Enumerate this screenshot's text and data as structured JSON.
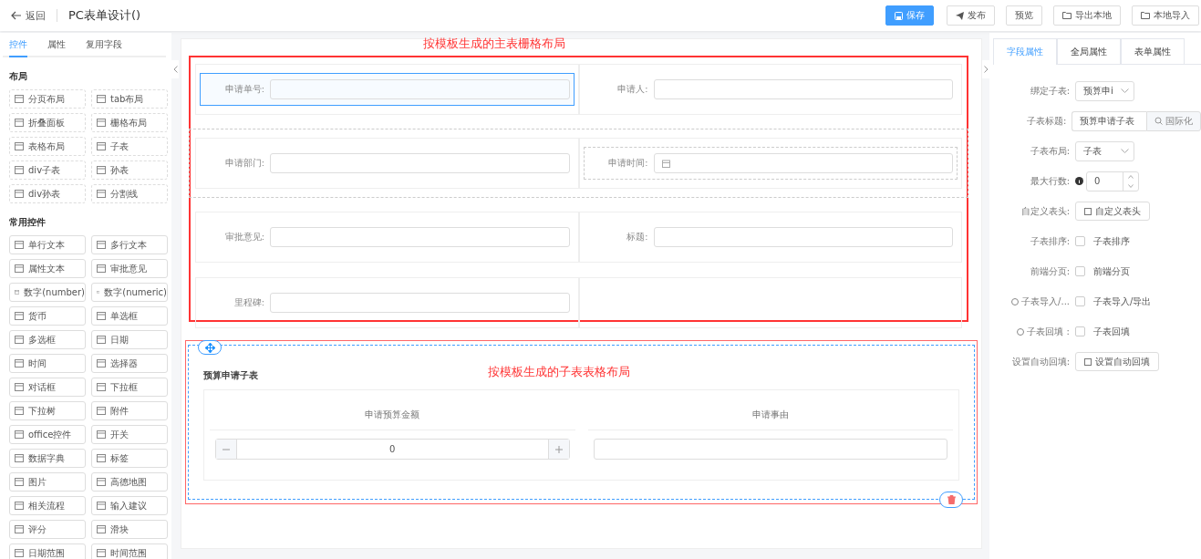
{
  "header": {
    "back_label": "返回",
    "title": "PC表单设计()",
    "buttons": [
      {
        "label": "保存",
        "kind": "primary"
      },
      {
        "label": "发布",
        "kind": "send"
      },
      {
        "label": "预览",
        "kind": "plain"
      },
      {
        "label": "导出本地",
        "kind": "folder"
      },
      {
        "label": "本地导入",
        "kind": "folder"
      }
    ]
  },
  "left_panel": {
    "tabs": [
      {
        "label": "控件",
        "selected": true
      },
      {
        "label": "属性",
        "selected": false
      },
      {
        "label": "复用字段",
        "selected": false
      }
    ],
    "sections": [
      {
        "title": "布局",
        "items": [
          "分页布局",
          "tab布局",
          "折叠面板",
          "栅格布局",
          "表格布局",
          "子表",
          "div子表",
          "孙表",
          "div孙表",
          "分割线"
        ]
      },
      {
        "title": "常用控件",
        "items": [
          "单行文本",
          "多行文本",
          "属性文本",
          "审批意见",
          "数字(number)",
          "数字(numeric)",
          "货币",
          "单选框",
          "多选框",
          "日期",
          "时间",
          "选择器",
          "对话框",
          "下拉框",
          "下拉树",
          "附件",
          "office控件",
          "开关",
          "数据字典",
          "标签",
          "图片",
          "高德地图",
          "相关流程",
          "输入建议",
          "评分",
          "滑块",
          "日期范围",
          "时间范围"
        ]
      }
    ]
  },
  "canvas": {
    "main_annotation": "按模板生成的主表栅格布局",
    "main_grid": [
      {
        "highlighted": false,
        "cells": [
          {
            "label": "申请单号:",
            "kind": "text",
            "selected": true
          },
          {
            "label": "申请人:",
            "kind": "text",
            "selected": false
          }
        ]
      },
      {
        "highlighted": true,
        "cells": [
          {
            "label": "申请部门:",
            "kind": "text",
            "selected": false
          },
          {
            "label": "申请时间:",
            "kind": "date",
            "selected": false
          }
        ]
      },
      {
        "highlighted": false,
        "cells": [
          {
            "label": "审批意见:",
            "kind": "text",
            "selected": false
          },
          {
            "label": "标题:",
            "kind": "text",
            "selected": false
          }
        ]
      },
      {
        "highlighted": false,
        "cells": [
          {
            "label": "里程碑:",
            "kind": "text",
            "selected": false
          },
          {
            "kind": "empty",
            "selected": false
          }
        ]
      }
    ],
    "sub_annotation": "按模板生成的子表表格布局",
    "subtable": {
      "title": "预算申请子表",
      "columns": [
        "申请预算金额",
        "申请事由"
      ],
      "number_value": "0"
    }
  },
  "right_panel": {
    "tabs": [
      {
        "label": "字段属性",
        "selected": true
      },
      {
        "label": "全局属性",
        "selected": false
      },
      {
        "label": "表单属性",
        "selected": false
      }
    ],
    "props": [
      {
        "label": "绑定子表:",
        "kind": "select",
        "value": "预算申i"
      },
      {
        "label": "子表标题:",
        "kind": "input",
        "value": "预算申请子表",
        "addon": "国际化"
      },
      {
        "label": "子表布局:",
        "kind": "select",
        "value": "子表"
      },
      {
        "label": "最大行数:",
        "kind": "number",
        "value": "0",
        "info": true
      },
      {
        "label": "自定义表头:",
        "kind": "button",
        "value": "自定义表头"
      },
      {
        "label": "子表排序:",
        "kind": "checkbox",
        "value": "子表排序",
        "checked": false
      },
      {
        "label": "前端分页:",
        "kind": "checkbox",
        "value": "前端分页",
        "checked": false
      },
      {
        "label": "子表导入/...",
        "kind": "checkbox",
        "value": "子表导入/导出",
        "checked": false,
        "help": true
      },
      {
        "label": "子表回填 :",
        "kind": "checkbox",
        "value": "子表回填",
        "checked": false,
        "help": true
      },
      {
        "label": "设置自动回填:",
        "kind": "button",
        "value": "设置自动回填"
      }
    ]
  }
}
